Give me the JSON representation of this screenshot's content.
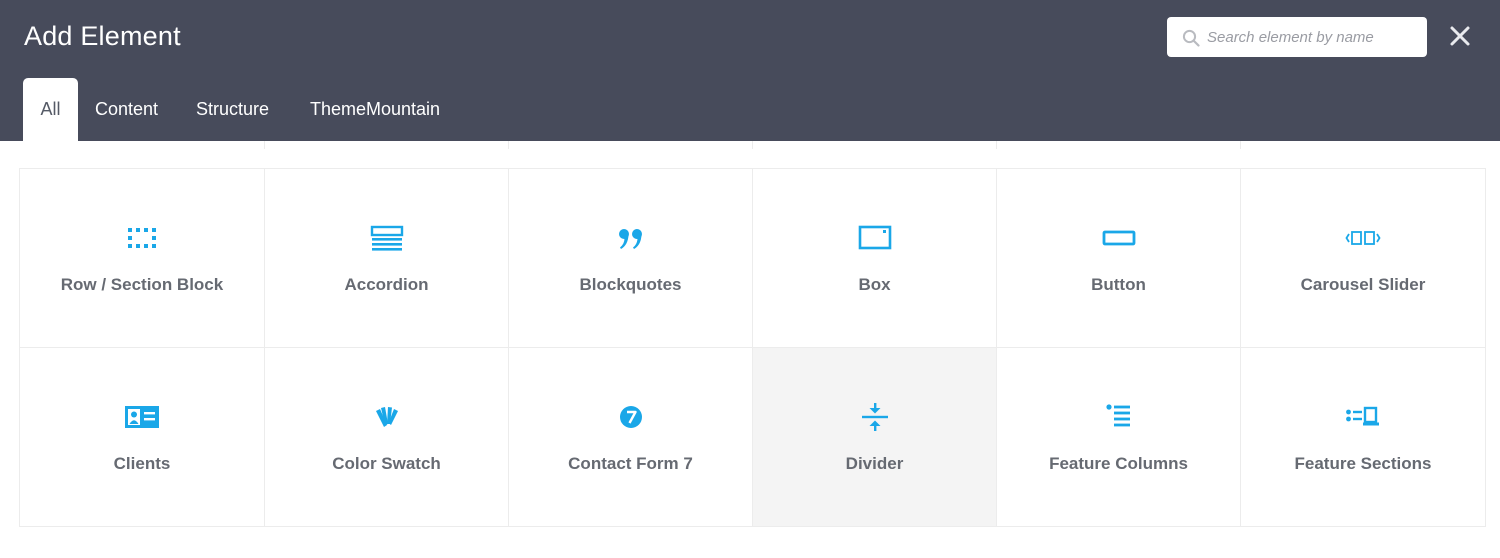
{
  "header": {
    "title": "Add Element",
    "background": "#474b5b",
    "search": {
      "placeholder": "Search element by name",
      "value": "",
      "icon": "search-icon"
    },
    "close_icon": "close-icon"
  },
  "tabs": [
    {
      "label": "All",
      "active": true
    },
    {
      "label": "Content",
      "active": false
    },
    {
      "label": "Structure",
      "active": false
    },
    {
      "label": "ThemeMountain",
      "active": false
    }
  ],
  "accent_color": "#1aa7e8",
  "elements": [
    {
      "label": "Row / Section Block",
      "icon": "row-grid-icon"
    },
    {
      "label": "Accordion",
      "icon": "accordion-icon"
    },
    {
      "label": "Blockquotes",
      "icon": "quote-icon"
    },
    {
      "label": "Box",
      "icon": "box-icon"
    },
    {
      "label": "Button",
      "icon": "button-icon"
    },
    {
      "label": "Carousel Slider",
      "icon": "carousel-icon"
    },
    {
      "label": "Clients",
      "icon": "clients-card-icon"
    },
    {
      "label": "Color Swatch",
      "icon": "color-swatch-icon"
    },
    {
      "label": "Contact Form 7",
      "icon": "contact-form-7-icon"
    },
    {
      "label": "Divider",
      "icon": "divider-icon",
      "highlighted": true
    },
    {
      "label": "Feature Columns",
      "icon": "feature-columns-icon"
    },
    {
      "label": "Feature Sections",
      "icon": "feature-sections-icon"
    }
  ]
}
